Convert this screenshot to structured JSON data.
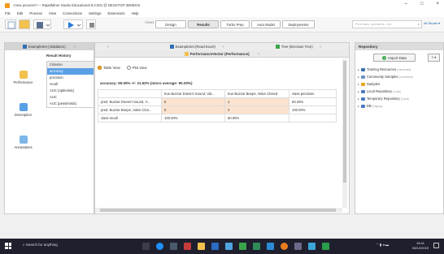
{
  "window": {
    "title": "<new process*> – RapidMiner Studio Educational 9.0.001 @ DESKTOP-39NEKI5",
    "buttons": {
      "minimize": "–",
      "maximize": "□",
      "close": "×"
    }
  },
  "menu": [
    "File",
    "Edit",
    "Process",
    "View",
    "Connections",
    "Settings",
    "Extensions",
    "Help"
  ],
  "toolbar": {
    "views_label": "Views",
    "view_tabs": [
      "Design",
      "Results",
      "Turbo Prep",
      "Auto Model",
      "Deployments"
    ],
    "active_view": "Results",
    "search_placeholder": "Find data, operators...etc",
    "all_studio": "All Studio ▾"
  },
  "results_panel": {
    "tabs": [
      "ExampleSet (Validation)",
      "ExampleSet (Read Excel)",
      "Tree (Decision Tree)"
    ],
    "header": "Result History",
    "nav": [
      "Performance",
      "Description",
      "Annotations"
    ],
    "criteria_header": "Criterion",
    "criteria": [
      "accuracy",
      "precision",
      "recall",
      "AUC (optimistic)",
      "AUC",
      "AUC (pessimistic)"
    ],
    "selected_criterion": "accuracy"
  },
  "performance": {
    "tab": "PerformanceVector (Performance)",
    "table_view": "Table View",
    "plot_view": "Plot View",
    "accuracy_line": "accuracy: 90.00% +/- 31.62% (micro average: 90.00%)",
    "columns": [
      "",
      "true Buzzar Doesn't Sound, Val...",
      "true Buzzar Beeps, Valve Closed",
      "class precision"
    ],
    "rows": [
      [
        "pred. Buzzar Doesn't Sound, V...",
        "5",
        "1",
        "83.33%"
      ],
      [
        "pred. Buzzar Beeps, Valve Clos...",
        "0",
        "4",
        "100.00%"
      ],
      [
        "class recall",
        "100.00%",
        "80.00%",
        ""
      ]
    ]
  },
  "repository": {
    "title": "Repository",
    "import_label": "Import Data",
    "menu_label": "≡ ▾",
    "items": [
      {
        "label": "Training Resources",
        "suffix": "(connected)",
        "color": "#3a6fb0"
      },
      {
        "label": "Community Samples",
        "suffix": "(connected)",
        "color": "#6a8fc2"
      },
      {
        "label": "Samples",
        "suffix": "",
        "color": "#e8a317"
      },
      {
        "label": "Local Repository",
        "suffix": "(Local)",
        "color": "#4a7cc4"
      },
      {
        "label": "Temporary Repository",
        "suffix": "(Local)",
        "color": "#4a7cc4"
      },
      {
        "label": "DB",
        "suffix": "(Legacy)",
        "color": "#4a7cc4"
      }
    ]
  },
  "taskbar": {
    "search": "Search for anything",
    "time": "18:41",
    "date": "05/12/2019"
  }
}
